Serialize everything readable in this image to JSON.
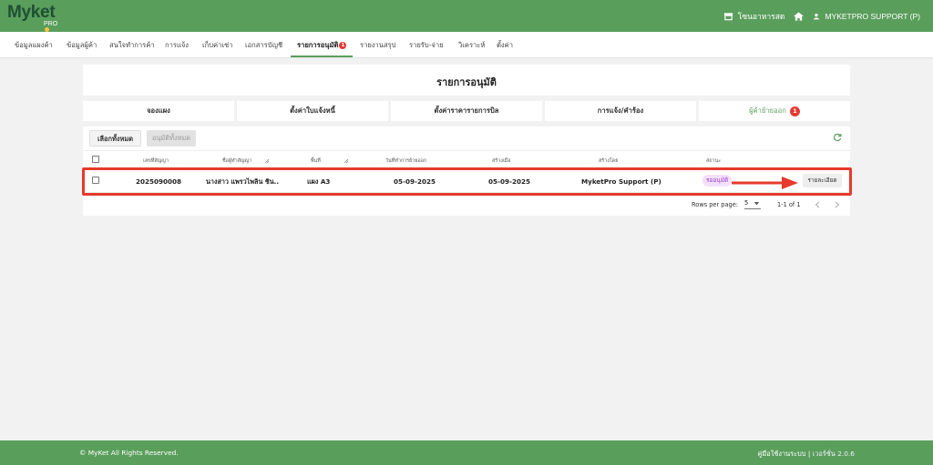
{
  "brand": {
    "name": "Myket",
    "sub": "PRO"
  },
  "topbar": {
    "store_label": "โซนอาหารสด",
    "user_label": "MYKETPRO SUPPORT (P)"
  },
  "nav": {
    "items": [
      {
        "label": "ข้อมูลแผงค้า"
      },
      {
        "label": "ข้อมูลผู้ค้า"
      },
      {
        "label": "สนใจทำการค้า"
      },
      {
        "label": "การแจ้ง"
      },
      {
        "label": "เก็บค่าเช่า"
      },
      {
        "label": "เอกสารบัญชี"
      },
      {
        "label": "รายการอนุมัติ",
        "badge": "1"
      },
      {
        "label": "รายงานสรุป"
      },
      {
        "label": "รายรับ-จ่าย"
      },
      {
        "label": "วิเคราะห์"
      },
      {
        "label": "ตั้งค่า"
      }
    ]
  },
  "page_title": "รายการอนุมัติ",
  "subtabs": [
    {
      "label": "จองแผง"
    },
    {
      "label": "ตั้งค่าใบแจ้งหนี้"
    },
    {
      "label": "ตั้งค่าราคารายการบิล"
    },
    {
      "label": "การแจ้ง/คำร้อง"
    },
    {
      "label": "ผู้ค้าย้ายออก",
      "badge": "1"
    }
  ],
  "toolbar": {
    "select_all": "เลือกทั้งหมด",
    "approve_all": "อนุมัติทั้งหมด"
  },
  "table": {
    "headers": [
      "เลขที่สัญญา",
      "ชื่อผู้ทำสัญญา",
      "พื้นที่",
      "วันที่ทำการย้ายออก",
      "สร้างเมื่อ",
      "สร้างโดย",
      "สถานะ"
    ],
    "rows": [
      {
        "contract_no": "2025090008",
        "contract_name": "นางสาว แพรวไพลิน ชิน..",
        "area": "แผง A3",
        "move_out_date": "05-09-2025",
        "created_at": "05-09-2025",
        "created_by": "MyketPro Support (P)",
        "status": "รออนุมัติ",
        "detail_label": "รายละเอียด"
      }
    ]
  },
  "pagination": {
    "rows_per_page_label": "Rows per page:",
    "rows_per_page": "5",
    "range": "1-1 of 1"
  },
  "footer": {
    "copyright": "© MyKet All Rights Reserved.",
    "manual": "คู่มือใช้งานระบบ",
    "version": "เวอร์ชั่น 2.0.6"
  },
  "colors": {
    "primary": "#5a9e5c",
    "highlight": "#e53a2c",
    "badge": "#e53935",
    "status_chip": "#f3e0fb"
  }
}
